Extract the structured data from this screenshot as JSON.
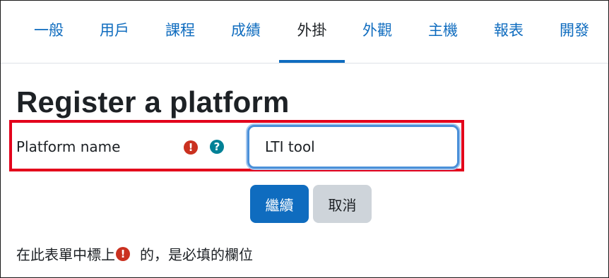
{
  "nav": {
    "tabs": [
      {
        "label": "一般"
      },
      {
        "label": "用戶"
      },
      {
        "label": "課程"
      },
      {
        "label": "成績"
      },
      {
        "label": "外掛",
        "active": true
      },
      {
        "label": "外觀"
      },
      {
        "label": "主機"
      },
      {
        "label": "報表"
      },
      {
        "label": "開發"
      }
    ]
  },
  "page": {
    "title": "Register a platform"
  },
  "form": {
    "platform_name": {
      "label": "Platform name",
      "value": "LTI tool",
      "required_icon": "exclamation-circle-icon",
      "help_icon": "question-circle-icon"
    },
    "submit_label": "繼續",
    "cancel_label": "取消",
    "required_note_before": "在此表單中標上",
    "required_note_after": "的，是必填的欄位"
  },
  "colors": {
    "accent": "#0f6cbf",
    "required": "#ca3120",
    "help": "#008196",
    "highlight_border": "#e3001b",
    "secondary_button": "#ced4da"
  }
}
